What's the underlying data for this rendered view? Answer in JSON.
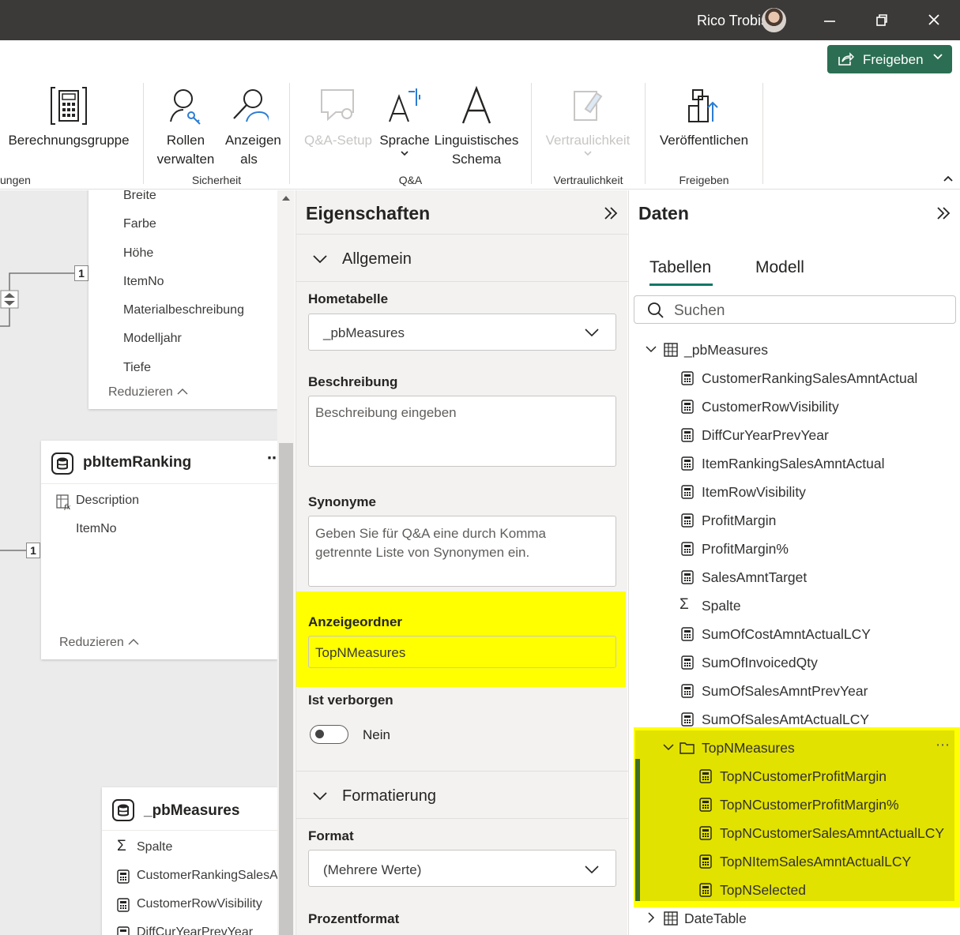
{
  "titlebar": {
    "user": "Rico Trobisch"
  },
  "share": {
    "label": "Freigeben"
  },
  "ribbon": {
    "buttons": [
      {
        "id": "calc",
        "label": "Berechnungsgruppe"
      },
      {
        "id": "roles",
        "label": "Rollen verwalten"
      },
      {
        "id": "viewas",
        "label": "Anzeigen als"
      },
      {
        "id": "qa",
        "label": "Q&A-Setup"
      },
      {
        "id": "lang",
        "label": "Sprache"
      },
      {
        "id": "schema",
        "label": "Linguistisches Schema"
      },
      {
        "id": "sens",
        "label": "Vertraulichkeit"
      },
      {
        "id": "publish",
        "label": "Veröffentlichen"
      }
    ],
    "groups": {
      "g0": "ungen",
      "security": "Sicherheit",
      "qa": "Q&A",
      "sens": "Vertraulichkeit",
      "share": "Freigeben"
    }
  },
  "canvas": {
    "card1": {
      "fields": [
        "Breite",
        "Farbe",
        "Höhe",
        "ItemNo",
        "Materialbeschreibung",
        "Modelljahr",
        "Tiefe"
      ],
      "reduce": "Reduzieren"
    },
    "card2": {
      "title": "pbItemRanking",
      "fields": [
        "Description",
        "ItemNo"
      ],
      "reduce": "Reduzieren"
    },
    "card3": {
      "title": "_pbMeasures",
      "fields": [
        "Spalte",
        "CustomerRankingSalesA",
        "CustomerRowVisibility",
        "DiffCurYearPrevYear"
      ]
    },
    "rel_label": "1"
  },
  "props": {
    "title": "Eigenschaften",
    "general": "Allgemein",
    "home_label": "Hometabelle",
    "home_value": "_pbMeasures",
    "desc_label": "Beschreibung",
    "desc_placeholder": "Beschreibung eingeben",
    "syn_label": "Synonyme",
    "syn_placeholder": "Geben Sie für Q&A eine durch Komma getrennte Liste von Synonymen ein.",
    "folder_label": "Anzeigeordner",
    "folder_value": "TopNMeasures",
    "hidden_label": "Ist verborgen",
    "hidden_value": "Nein",
    "format_section": "Formatierung",
    "format_label": "Format",
    "format_value": "(Mehrere Werte)",
    "percent_label": "Prozentformat"
  },
  "daten": {
    "title": "Daten",
    "tabs": [
      "Tabellen",
      "Modell"
    ],
    "search_placeholder": "Suchen",
    "table": "_pbMeasures",
    "measures": [
      "CustomerRankingSalesAmntActual",
      "CustomerRowVisibility",
      "DiffCurYearPrevYear",
      "ItemRankingSalesAmntActual",
      "ItemRowVisibility",
      "ProfitMargin",
      "ProfitMargin%",
      "SalesAmntTarget"
    ],
    "column": "Spalte",
    "measures2": [
      "SumOfCostAmntActualLCY",
      "SumOfInvoicedQty",
      "SumOfSalesAmntPrevYear",
      "SumOfSalesAmtActualLCY"
    ],
    "folder": "TopNMeasures",
    "folder_items": [
      "TopNCustomerProfitMargin",
      "TopNCustomerProfitMargin%",
      "TopNCustomerSalesAmntActualLCY",
      "TopNItemSalesAmntActualLCY",
      "TopNSelected"
    ],
    "next_table": "DateTable"
  }
}
